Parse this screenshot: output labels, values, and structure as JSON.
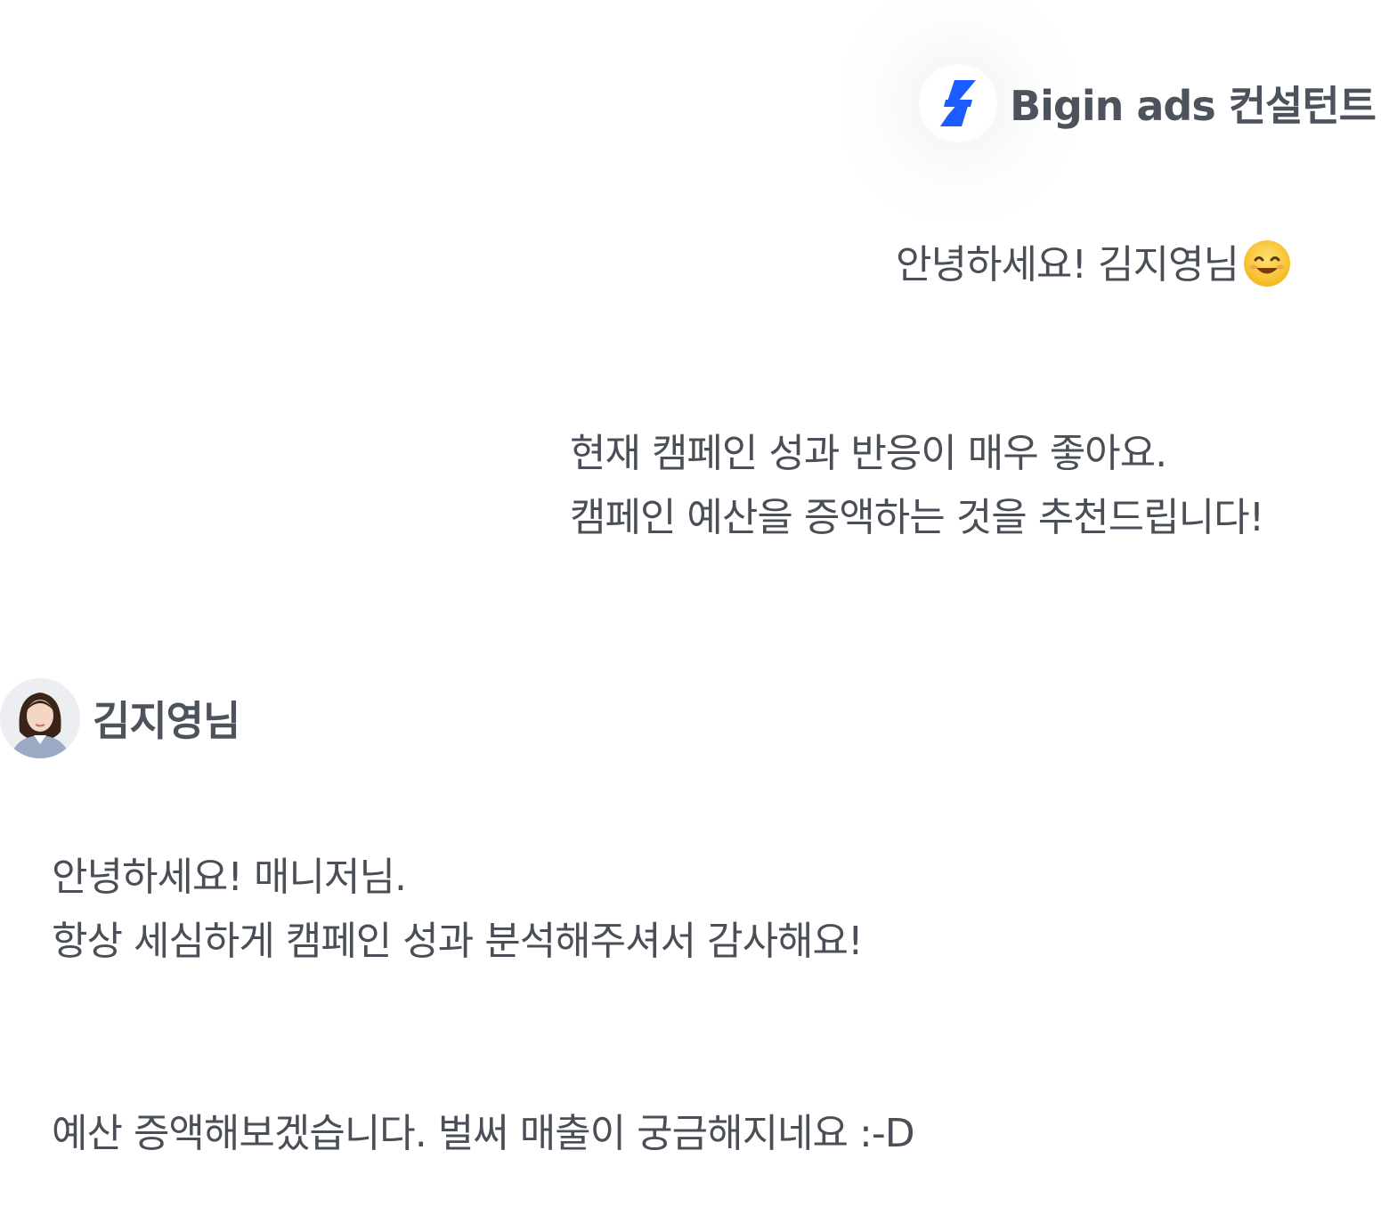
{
  "consultant": {
    "name": "Bigin ads 컨설턴트",
    "icon": "lightning-bolt-icon",
    "brand_color": "#1a5cff"
  },
  "messages_consultant": [
    {
      "text": "안녕하세요! 김지영님",
      "emoji": "smiling-face-emoji"
    },
    {
      "lines": [
        "현재 캠페인 성과 반응이 매우 좋아요.",
        "캠페인 예산을 증액하는 것을 추천드립니다!"
      ]
    }
  ],
  "user": {
    "name": "김지영님",
    "avatar": "user-photo"
  },
  "messages_user": [
    {
      "lines": [
        "안녕하세요! 매니저님.",
        "항상 세심하게 캠페인 성과 분석해주셔서 감사해요!"
      ]
    },
    {
      "text": "예산 증액해보겠습니다. 벌써 매출이 궁금해지네요 :-D"
    }
  ]
}
